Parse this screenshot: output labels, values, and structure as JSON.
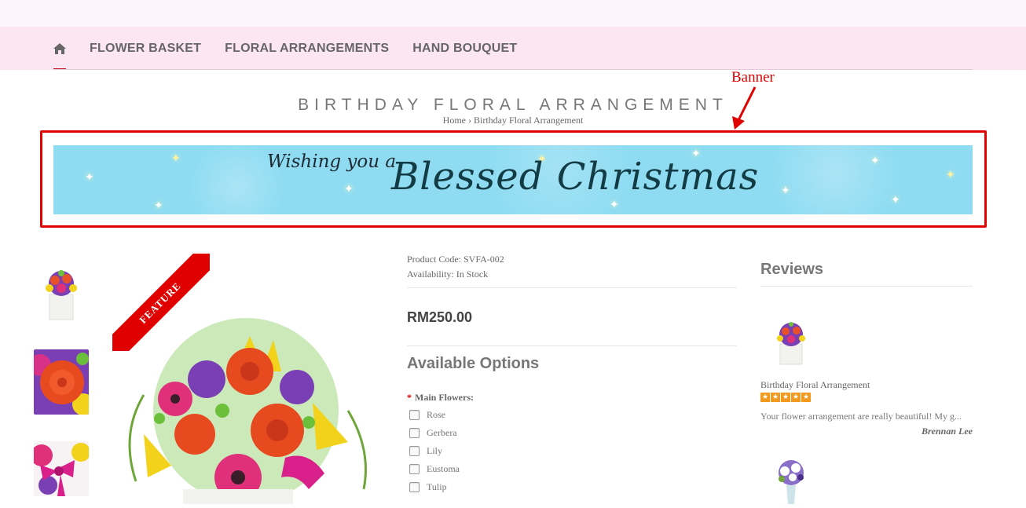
{
  "nav": {
    "home_icon": "home-icon",
    "items": [
      {
        "label": "FLOWER BASKET"
      },
      {
        "label": "FLORAL ARRANGEMENTS"
      },
      {
        "label": "HAND BOUQUET"
      }
    ]
  },
  "annotation": {
    "label": "Banner",
    "color": "#e00000"
  },
  "page": {
    "title": "BIRTHDAY FLORAL ARRANGEMENT",
    "breadcrumb": {
      "home": "Home",
      "separator": "›",
      "current": "Birthday Floral Arrangement"
    }
  },
  "banner": {
    "line1": "Wishing you a",
    "line2": "Blessed Christmas",
    "background": "#8fdcf2"
  },
  "product": {
    "ribbon": "FEATURE",
    "code_label": "Product Code:",
    "code": "SVFA-002",
    "availability_label": "Availability:",
    "availability": "In Stock",
    "price": "RM250.00"
  },
  "options": {
    "title": "Available Options",
    "required_mark": "*",
    "group_label": "Main Flowers:",
    "items": [
      "Rose",
      "Gerbera",
      "Lily",
      "Eustoma",
      "Tulip"
    ]
  },
  "reviews": {
    "title": "Reviews",
    "items": [
      {
        "product": "Birthday Floral Arrangement",
        "rating": 5,
        "text": "Your flower arrangement are really beautiful! My g...",
        "author": "Brennan Lee"
      }
    ]
  },
  "colors": {
    "nav_bg": "#fbe6f2",
    "accent": "#c8102e",
    "star": "#f29a1f"
  }
}
